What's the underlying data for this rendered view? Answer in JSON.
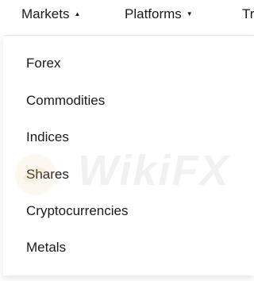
{
  "nav": {
    "items": [
      {
        "label": "Markets",
        "caret": "▲"
      },
      {
        "label": "Platforms",
        "caret": "▼"
      },
      {
        "label": "Tr"
      }
    ]
  },
  "menu": {
    "items": [
      {
        "label": "Forex"
      },
      {
        "label": "Commodities"
      },
      {
        "label": "Indices"
      },
      {
        "label": "Shares"
      },
      {
        "label": "Cryptocurrencies"
      },
      {
        "label": "Metals"
      }
    ]
  },
  "watermark": {
    "text": "WikiFX"
  },
  "colors": {
    "text": "#1a1a1a",
    "background": "#ffffff",
    "border": "#e6e6e6"
  }
}
